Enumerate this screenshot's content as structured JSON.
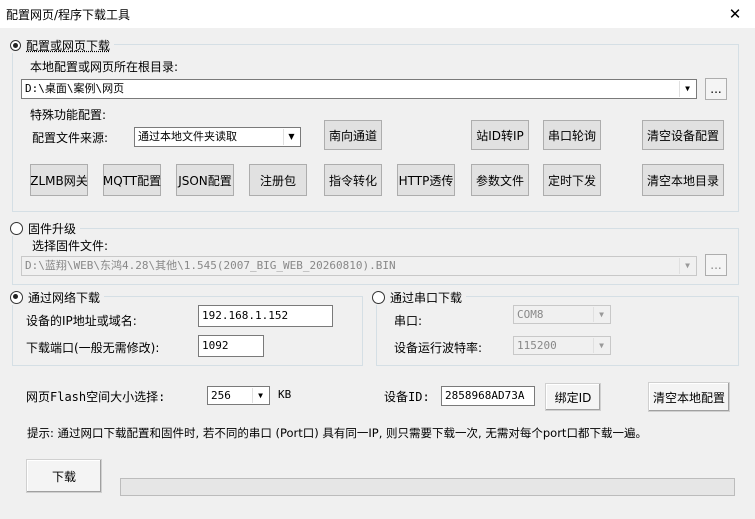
{
  "window": {
    "title": "配置网页/程序下载工具",
    "close_glyph": "✕"
  },
  "web_download": {
    "radio_label": "配置或网页下载",
    "root_dir_label": "本地配置或网页所在根目录:",
    "root_dir_value": "D:\\桌面\\案例\\网页",
    "browse_label": "...",
    "special_label": "特殊功能配置:",
    "source_label": "配置文件来源:",
    "source_value": "通过本地文件夹读取",
    "buttons": {
      "south": "南向通道",
      "station_id": "站ID转IP",
      "serial_poll": "串口轮询",
      "clear_device": "清空设备配置",
      "zlmb": "ZLMB网关",
      "mqtt": "MQTT配置",
      "json": "JSON配置",
      "register": "注册包",
      "command": "指令转化",
      "http": "HTTP透传",
      "param": "参数文件",
      "timer": "定时下发",
      "clear_dir": "清空本地目录"
    }
  },
  "firmware": {
    "radio_label": "固件升级",
    "select_label": "选择固件文件:",
    "file_value": "D:\\蓝翔\\WEB\\东鸿4.28\\其他\\1.545(2007_BIG_WEB_20260810).BIN",
    "browse_label": "..."
  },
  "network": {
    "radio_label": "通过网络下载",
    "ip_label": "设备的IP地址或域名:",
    "ip_value": "192.168.1.152",
    "port_label": "下载端口(一般无需修改):",
    "port_value": "1092"
  },
  "serial": {
    "radio_label": "通过串口下载",
    "port_label": "串口:",
    "port_value": "COM8",
    "baud_label": "设备运行波特率:",
    "baud_value": "115200"
  },
  "flash": {
    "label": "网页Flash空间大小选择:",
    "value": "256",
    "unit": "KB",
    "device_id_label": "设备ID:",
    "device_id_value": "2858968AD73A",
    "bind_label": "绑定ID",
    "clear_local_label": "清空本地配置"
  },
  "tip": "提示: 通过网口下载配置和固件时, 若不同的串口 (Port口) 具有同一IP, 则只需要下载一次, 无需对每个port口都下载一遍。",
  "download_button": "下载",
  "progress": 0
}
